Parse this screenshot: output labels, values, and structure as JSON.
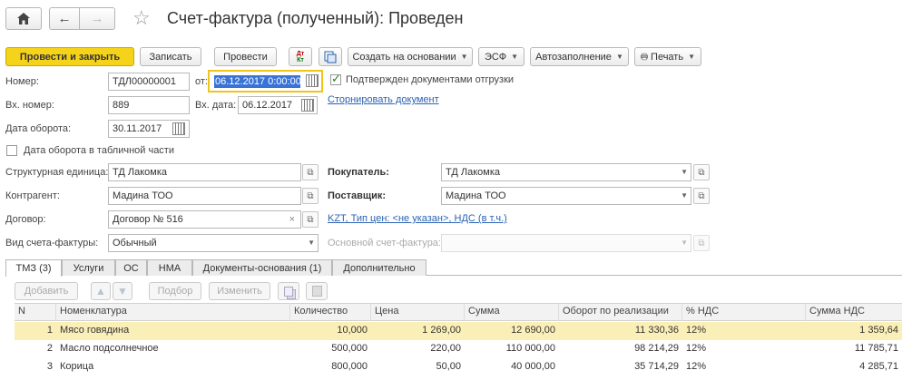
{
  "window": {
    "title": "Счет-фактура (полученный): Проведен"
  },
  "toolbar": {
    "post_close": "Провести и закрыть",
    "save": "Записать",
    "post": "Провести",
    "create_based": "Создать на основании",
    "esf": "ЭСФ",
    "autofill": "Автозаполнение",
    "print": "Печать"
  },
  "form": {
    "number_label": "Номер:",
    "number": "ТДЛ00000001",
    "from_label": "от:",
    "date": "06.12.2017  0:00:00",
    "confirmed_label": "Подтвержден документами отгрузки",
    "confirmed": true,
    "in_number_label": "Вх. номер:",
    "in_number": "889",
    "in_date_label": "Вх. дата:",
    "in_date": "06.12.2017",
    "reverse_link": "Сторнировать документ",
    "turnover_date_label": "Дата оборота:",
    "turnover_date": "30.11.2017",
    "turnover_in_table_label": "Дата оборота в табличной части",
    "struct_unit_label": "Структурная единица:",
    "struct_unit": "ТД Лакомка",
    "buyer_label": "Покупатель:",
    "buyer": "ТД Лакомка",
    "counterparty_label": "Контрагент:",
    "counterparty": "Мадина ТОО",
    "supplier_label": "Поставщик:",
    "supplier": "Мадина ТОО",
    "contract_label": "Договор:",
    "contract": "Договор № 516",
    "price_link": "KZT, Тип цен: <не указан>, НДС (в т.ч.)",
    "invoice_type_label": "Вид счета-фактуры:",
    "invoice_type": "Обычный",
    "base_invoice_label": "Основной счет-фактура:"
  },
  "tabs": [
    "ТМЗ (3)",
    "Услуги",
    "ОС",
    "НМА",
    "Документы-основания (1)",
    "Дополнительно"
  ],
  "table_toolbar": {
    "add": "Добавить",
    "pick": "Подбор",
    "edit": "Изменить"
  },
  "table": {
    "headers": [
      "N",
      "Номенклатура",
      "Количество",
      "Цена",
      "Сумма",
      "Оборот по реализации",
      "% НДС",
      "Сумма НДС"
    ],
    "rows": [
      [
        "1",
        "Мясо говядина",
        "10,000",
        "1 269,00",
        "12 690,00",
        "11 330,36",
        "12%",
        "1 359,64"
      ],
      [
        "2",
        "Масло подсолнечное",
        "500,000",
        "220,00",
        "110 000,00",
        "98 214,29",
        "12%",
        "11 785,71"
      ],
      [
        "3",
        "Корица",
        "800,000",
        "50,00",
        "40 000,00",
        "35 714,29",
        "12%",
        "4 285,71"
      ]
    ]
  }
}
